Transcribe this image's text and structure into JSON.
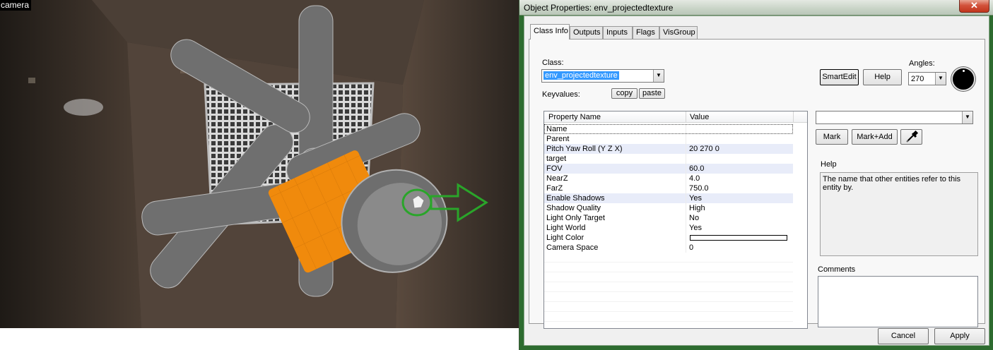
{
  "viewport": {
    "label": "camera"
  },
  "dialog": {
    "title": "Object Properties: env_projectedtexture",
    "close_glyph": "✕",
    "tabs": [
      {
        "label": "Class Info",
        "active": true
      },
      {
        "label": "Outputs",
        "active": false
      },
      {
        "label": "Inputs",
        "active": false
      },
      {
        "label": "Flags",
        "active": false
      },
      {
        "label": "VisGroup",
        "active": false
      }
    ],
    "class_label": "Class:",
    "class_value": "env_projectedtexture",
    "keyvalues_label": "Keyvalues:",
    "copy_label": "copy",
    "paste_label": "paste",
    "smartedit_label": "SmartEdit",
    "help_button_label": "Help",
    "angles_label": "Angles:",
    "angles_value": "270",
    "grid": {
      "headers": [
        "Property Name",
        "Value"
      ],
      "rows": [
        {
          "name": "Name",
          "value": ""
        },
        {
          "name": "Parent",
          "value": ""
        },
        {
          "name": "Pitch Yaw Roll (Y Z X)",
          "value": "20 270 0"
        },
        {
          "name": "target",
          "value": ""
        },
        {
          "name": "FOV",
          "value": "60.0"
        },
        {
          "name": "NearZ",
          "value": "4.0"
        },
        {
          "name": "FarZ",
          "value": "750.0"
        },
        {
          "name": "Enable Shadows",
          "value": "Yes"
        },
        {
          "name": "Shadow Quality",
          "value": "High"
        },
        {
          "name": "Light Only Target",
          "value": "No"
        },
        {
          "name": "Light World",
          "value": "Yes"
        },
        {
          "name": "Light Color",
          "value": ""
        },
        {
          "name": "Camera Space",
          "value": "0"
        }
      ],
      "light_color": "#ffffff"
    },
    "value_combo": "",
    "mark_label": "Mark",
    "markadd_label": "Mark+Add",
    "help_section_label": "Help",
    "help_text": "The name that other entities refer to this entity by.",
    "comments_label": "Comments",
    "comments_value": "",
    "cancel_label": "Cancel",
    "apply_label": "Apply",
    "icons": {
      "close": "close-icon",
      "dropdown": "chevron-down-icon",
      "picker": "eyedropper-icon"
    },
    "colors": {
      "selection": "#3399ff",
      "object_orange": "#f08a0c",
      "object_gray": "#7a7a7a",
      "gizmo_green": "#2aa52a"
    }
  }
}
